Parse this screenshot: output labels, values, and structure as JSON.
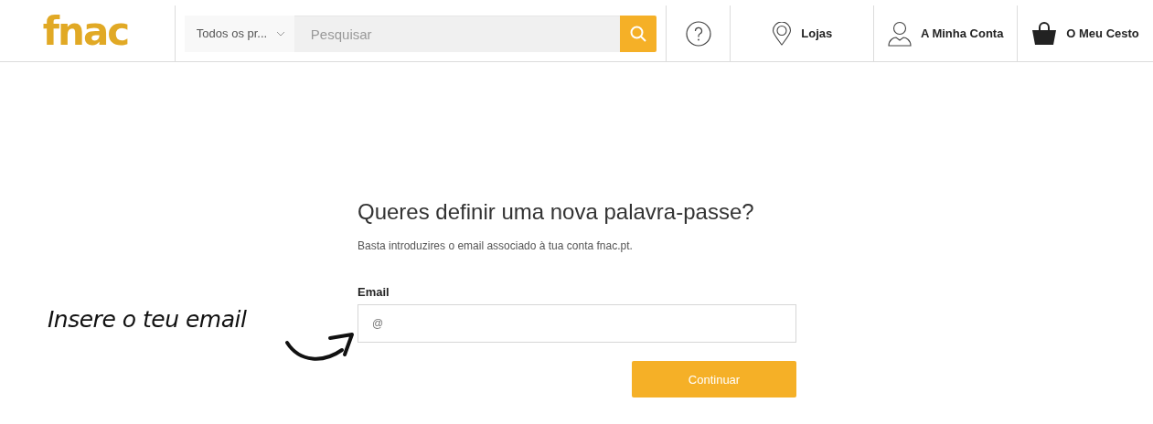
{
  "header": {
    "logo": "fnac",
    "category_select": {
      "value": "Todos os pr..."
    },
    "search": {
      "placeholder": "Pesquisar"
    },
    "nav": [
      {
        "kind": "help"
      },
      {
        "kind": "stores",
        "label": "Lojas"
      },
      {
        "kind": "account",
        "label": "A Minha Conta"
      },
      {
        "kind": "basket",
        "label": "O Meu Cesto"
      }
    ]
  },
  "form": {
    "title": "Queres definir uma nova palavra-passe?",
    "subtitle": "Basta introduzires o email associado à tua conta fnac.pt.",
    "email_label": "Email",
    "email_placeholder": "@",
    "submit": "Continuar"
  },
  "annotation": "Insere o teu email"
}
